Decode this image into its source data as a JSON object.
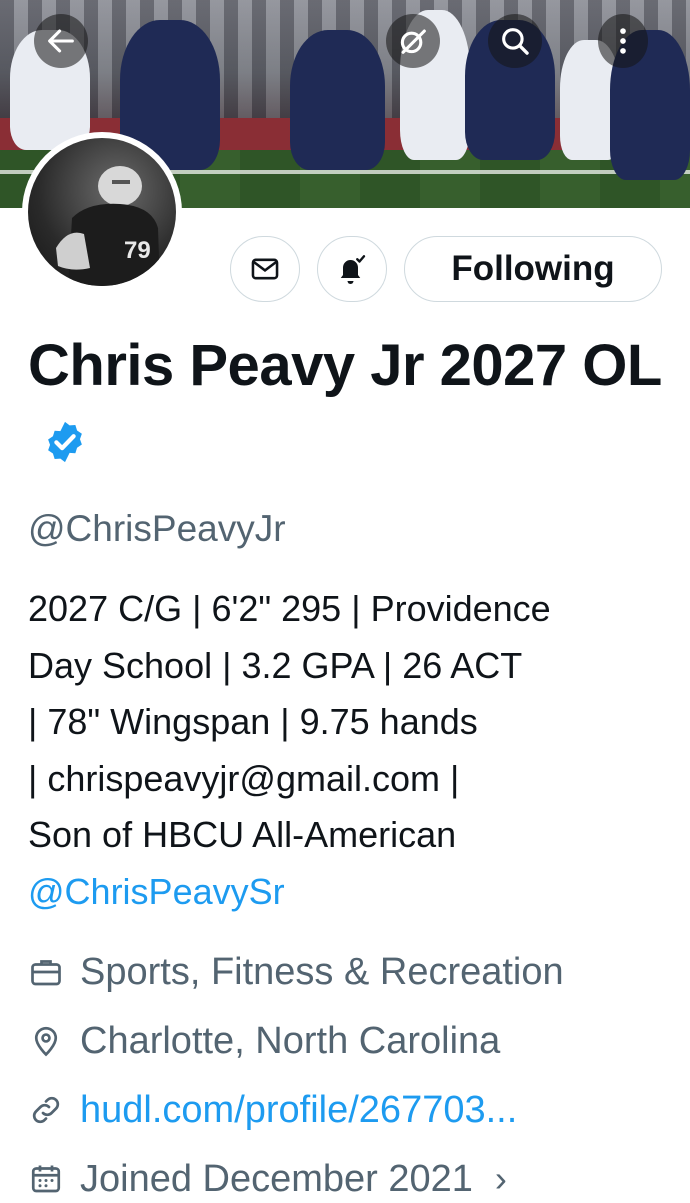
{
  "header": {
    "back_icon": "arrow-left-icon",
    "grok_icon": "grok-icon",
    "search_icon": "search-icon",
    "more_icon": "more-vertical-icon"
  },
  "profile": {
    "name": "Chris Peavy Jr 2027 OL",
    "handle": "@ChrisPeavyJr",
    "verified": true,
    "avatar_jersey_number": "79"
  },
  "actions": {
    "message_icon": "mail-icon",
    "notify_icon": "bell-check-icon",
    "follow_label": "Following"
  },
  "bio": {
    "lines": [
      "2027 C/G | 6'2\" 295 | Providence",
      "Day School | 3.2 GPA | 26 ACT",
      "| 78\" Wingspan | 9.75 hands",
      "| chrispeavyjr@gmail.com |",
      "Son of HBCU All-American"
    ],
    "mention": "@ChrisPeavySr"
  },
  "meta": {
    "category": "Sports, Fitness & Recreation",
    "location": "Charlotte, North Carolina",
    "website": "hudl.com/profile/267703...",
    "joined": "Joined December 2021"
  },
  "colors": {
    "accent": "#1d9bf0",
    "text": "#0f1419",
    "muted": "#536471",
    "border": "#cfd9de"
  }
}
